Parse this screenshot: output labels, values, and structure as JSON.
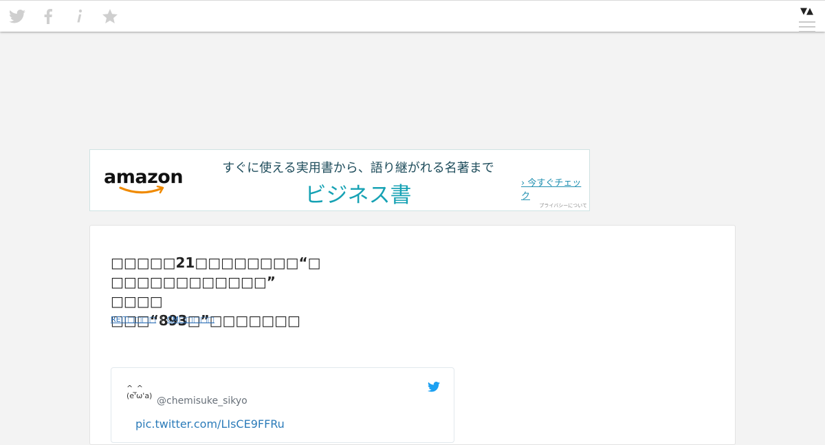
{
  "topbar": {
    "icons": [
      "twitter-icon",
      "facebook-icon",
      "info-icon",
      "star-icon"
    ],
    "right_arrows": "▼▲"
  },
  "ad": {
    "logo_text": "amazon",
    "tagline": "すぐに使える実用書から、語り継がれる名著まで",
    "headline": "ビジネス書",
    "cta": "› 今すぐチェック",
    "privacy": "プライバシーについて",
    "colors": {
      "headline": "#17a2b4",
      "logo_smile": "#f08a00"
    }
  },
  "article": {
    "title": "□□□□□21□□□□□□□□“□\n□□□□□□□□□□□□” □□□□\n□□□“893□”□□□□□□□",
    "tags": [
      "REIT□□□□",
      "CM□□□□□"
    ],
    "tag_separator": "|"
  },
  "tweet": {
    "avatar": "^_^\n(e'ω'a)",
    "handle": "@chemisuke_sikyo",
    "link": "pic.twitter.com/LIsCE9FFRu",
    "icon": "twitter-bird-icon"
  }
}
